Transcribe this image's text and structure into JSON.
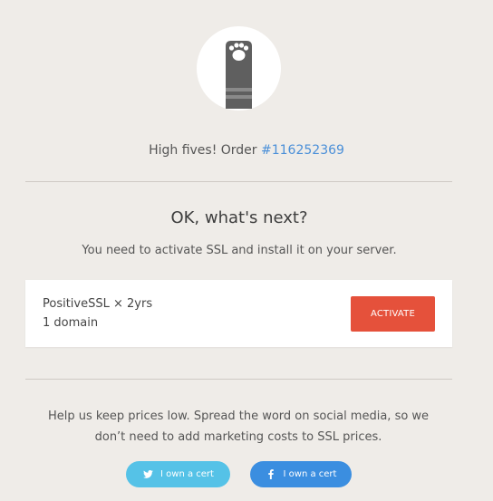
{
  "header": {
    "order_prefix": "High fives! Order",
    "order_number": "#116252369"
  },
  "next": {
    "title": "OK, what's next?",
    "subtitle": "You need to activate SSL and install it on your server."
  },
  "order_card": {
    "product": "PositiveSSL × 2yrs",
    "domains": "1 domain",
    "activate_label": "ACTIVATE"
  },
  "share": {
    "help_line_1": "Help us keep prices low. Spread the word on social media, so we",
    "help_line_2": "don’t need to add marketing costs to SSL prices.",
    "twitter_label": "I own a cert",
    "facebook_label": "I own a cert",
    "twitter_icon": "twitter-icon",
    "facebook_icon": "facebook-icon"
  },
  "colors": {
    "background": "#efece8",
    "accent_link": "#4a8fd8",
    "activate": "#e5513b",
    "twitter": "#55c2e7",
    "facebook": "#3b8ee0"
  }
}
